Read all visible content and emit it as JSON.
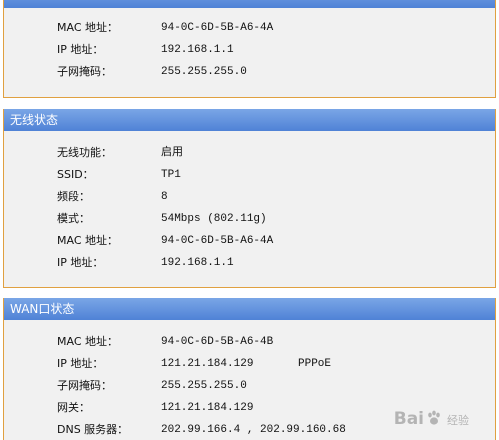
{
  "lan_status": {
    "title": "",
    "rows": [
      {
        "label": "MAC 地址：",
        "value": "94-0C-6D-5B-A6-4A"
      },
      {
        "label": "IP 地址：",
        "value": "192.168.1.1"
      },
      {
        "label": "子网掩码：",
        "value": "255.255.255.0"
      }
    ]
  },
  "wireless_status": {
    "title": "无线状态",
    "rows": [
      {
        "label": "无线功能：",
        "value": "启用"
      },
      {
        "label": "SSID：",
        "value": "TP1"
      },
      {
        "label": "频段：",
        "value": "8"
      },
      {
        "label": "模式：",
        "value": "54Mbps (802.11g)"
      },
      {
        "label": "MAC 地址：",
        "value": "94-0C-6D-5B-A6-4A"
      },
      {
        "label": "IP 地址：",
        "value": "192.168.1.1"
      }
    ]
  },
  "wan_status": {
    "title": "WAN口状态",
    "rows": [
      {
        "label": "MAC 地址：",
        "value": "94-0C-6D-5B-A6-4B"
      },
      {
        "label": "IP 地址：",
        "value": "121.21.184.129",
        "extra": "PPPoE"
      },
      {
        "label": "子网掩码：",
        "value": "255.255.255.0"
      },
      {
        "label": "网关：",
        "value": "121.21.184.129"
      },
      {
        "label": "DNS 服务器：",
        "value": "202.99.166.4 , 202.99.160.68"
      }
    ]
  },
  "watermark": {
    "text_left": "Bai",
    "text_right": "经验",
    "icon": "baidu-paw-icon"
  },
  "colors": {
    "header_blue": "#4f82d6",
    "border_orange": "#e0a040",
    "panel_bg": "#f1f1f1"
  }
}
